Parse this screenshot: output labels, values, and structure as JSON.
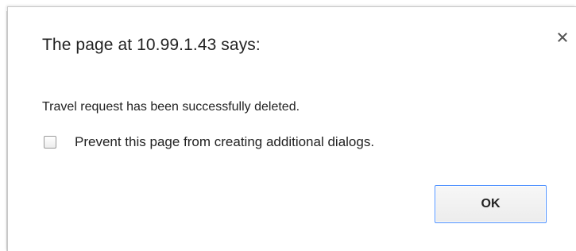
{
  "dialog": {
    "title": "The page at 10.99.1.43 says:",
    "message": "Travel request has been successfully deleted.",
    "prevent_dialogs_label": "Prevent this page from creating additional dialogs.",
    "prevent_dialogs_checked": false,
    "ok_label": "OK",
    "close_icon": "close-icon"
  },
  "colors": {
    "focus_border": "#4d90fe",
    "text": "#222222"
  }
}
